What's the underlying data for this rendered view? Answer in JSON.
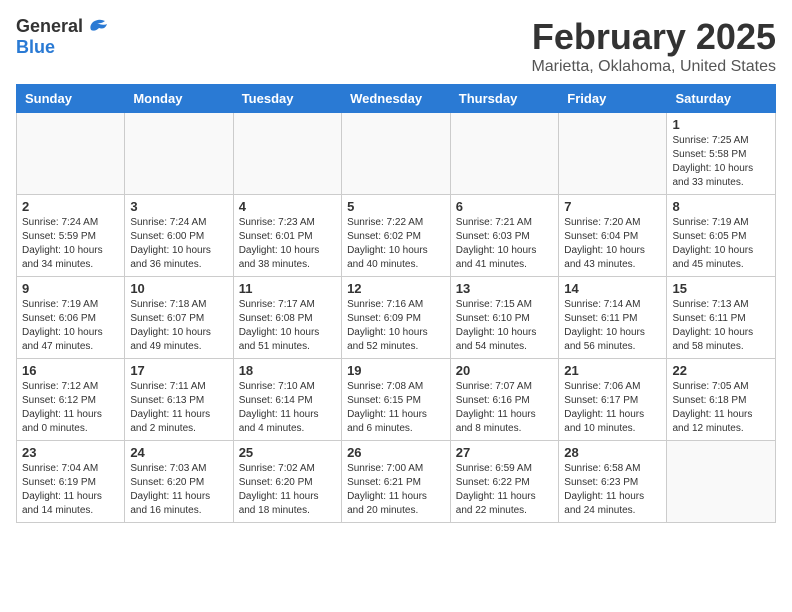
{
  "header": {
    "logo_general": "General",
    "logo_blue": "Blue",
    "month": "February 2025",
    "location": "Marietta, Oklahoma, United States"
  },
  "weekdays": [
    "Sunday",
    "Monday",
    "Tuesday",
    "Wednesday",
    "Thursday",
    "Friday",
    "Saturday"
  ],
  "weeks": [
    [
      {
        "day": "",
        "info": ""
      },
      {
        "day": "",
        "info": ""
      },
      {
        "day": "",
        "info": ""
      },
      {
        "day": "",
        "info": ""
      },
      {
        "day": "",
        "info": ""
      },
      {
        "day": "",
        "info": ""
      },
      {
        "day": "1",
        "info": "Sunrise: 7:25 AM\nSunset: 5:58 PM\nDaylight: 10 hours and 33 minutes."
      }
    ],
    [
      {
        "day": "2",
        "info": "Sunrise: 7:24 AM\nSunset: 5:59 PM\nDaylight: 10 hours and 34 minutes."
      },
      {
        "day": "3",
        "info": "Sunrise: 7:24 AM\nSunset: 6:00 PM\nDaylight: 10 hours and 36 minutes."
      },
      {
        "day": "4",
        "info": "Sunrise: 7:23 AM\nSunset: 6:01 PM\nDaylight: 10 hours and 38 minutes."
      },
      {
        "day": "5",
        "info": "Sunrise: 7:22 AM\nSunset: 6:02 PM\nDaylight: 10 hours and 40 minutes."
      },
      {
        "day": "6",
        "info": "Sunrise: 7:21 AM\nSunset: 6:03 PM\nDaylight: 10 hours and 41 minutes."
      },
      {
        "day": "7",
        "info": "Sunrise: 7:20 AM\nSunset: 6:04 PM\nDaylight: 10 hours and 43 minutes."
      },
      {
        "day": "8",
        "info": "Sunrise: 7:19 AM\nSunset: 6:05 PM\nDaylight: 10 hours and 45 minutes."
      }
    ],
    [
      {
        "day": "9",
        "info": "Sunrise: 7:19 AM\nSunset: 6:06 PM\nDaylight: 10 hours and 47 minutes."
      },
      {
        "day": "10",
        "info": "Sunrise: 7:18 AM\nSunset: 6:07 PM\nDaylight: 10 hours and 49 minutes."
      },
      {
        "day": "11",
        "info": "Sunrise: 7:17 AM\nSunset: 6:08 PM\nDaylight: 10 hours and 51 minutes."
      },
      {
        "day": "12",
        "info": "Sunrise: 7:16 AM\nSunset: 6:09 PM\nDaylight: 10 hours and 52 minutes."
      },
      {
        "day": "13",
        "info": "Sunrise: 7:15 AM\nSunset: 6:10 PM\nDaylight: 10 hours and 54 minutes."
      },
      {
        "day": "14",
        "info": "Sunrise: 7:14 AM\nSunset: 6:11 PM\nDaylight: 10 hours and 56 minutes."
      },
      {
        "day": "15",
        "info": "Sunrise: 7:13 AM\nSunset: 6:11 PM\nDaylight: 10 hours and 58 minutes."
      }
    ],
    [
      {
        "day": "16",
        "info": "Sunrise: 7:12 AM\nSunset: 6:12 PM\nDaylight: 11 hours and 0 minutes."
      },
      {
        "day": "17",
        "info": "Sunrise: 7:11 AM\nSunset: 6:13 PM\nDaylight: 11 hours and 2 minutes."
      },
      {
        "day": "18",
        "info": "Sunrise: 7:10 AM\nSunset: 6:14 PM\nDaylight: 11 hours and 4 minutes."
      },
      {
        "day": "19",
        "info": "Sunrise: 7:08 AM\nSunset: 6:15 PM\nDaylight: 11 hours and 6 minutes."
      },
      {
        "day": "20",
        "info": "Sunrise: 7:07 AM\nSunset: 6:16 PM\nDaylight: 11 hours and 8 minutes."
      },
      {
        "day": "21",
        "info": "Sunrise: 7:06 AM\nSunset: 6:17 PM\nDaylight: 11 hours and 10 minutes."
      },
      {
        "day": "22",
        "info": "Sunrise: 7:05 AM\nSunset: 6:18 PM\nDaylight: 11 hours and 12 minutes."
      }
    ],
    [
      {
        "day": "23",
        "info": "Sunrise: 7:04 AM\nSunset: 6:19 PM\nDaylight: 11 hours and 14 minutes."
      },
      {
        "day": "24",
        "info": "Sunrise: 7:03 AM\nSunset: 6:20 PM\nDaylight: 11 hours and 16 minutes."
      },
      {
        "day": "25",
        "info": "Sunrise: 7:02 AM\nSunset: 6:20 PM\nDaylight: 11 hours and 18 minutes."
      },
      {
        "day": "26",
        "info": "Sunrise: 7:00 AM\nSunset: 6:21 PM\nDaylight: 11 hours and 20 minutes."
      },
      {
        "day": "27",
        "info": "Sunrise: 6:59 AM\nSunset: 6:22 PM\nDaylight: 11 hours and 22 minutes."
      },
      {
        "day": "28",
        "info": "Sunrise: 6:58 AM\nSunset: 6:23 PM\nDaylight: 11 hours and 24 minutes."
      },
      {
        "day": "",
        "info": ""
      }
    ]
  ]
}
